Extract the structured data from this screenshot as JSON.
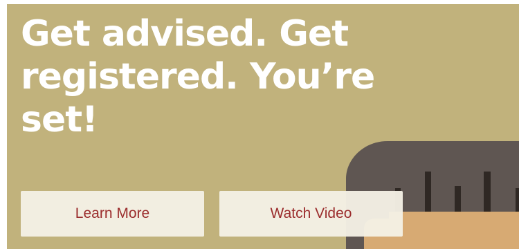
{
  "hero": {
    "headline": "Get advised. Get registered. You’re set!",
    "buttons": {
      "learn_more": "Learn More",
      "watch_video": "Watch Video"
    }
  },
  "colors": {
    "background": "#c1b27c",
    "headline_text": "#ffffff",
    "button_background": "#f4f0e5",
    "button_text": "#9b2d2d",
    "device": "#5f5652",
    "bars": "#2f2824",
    "card": "#d7aa73"
  },
  "icons": {
    "illustration": "device-card-illustration",
    "bars": "bar-chart-illustration"
  }
}
